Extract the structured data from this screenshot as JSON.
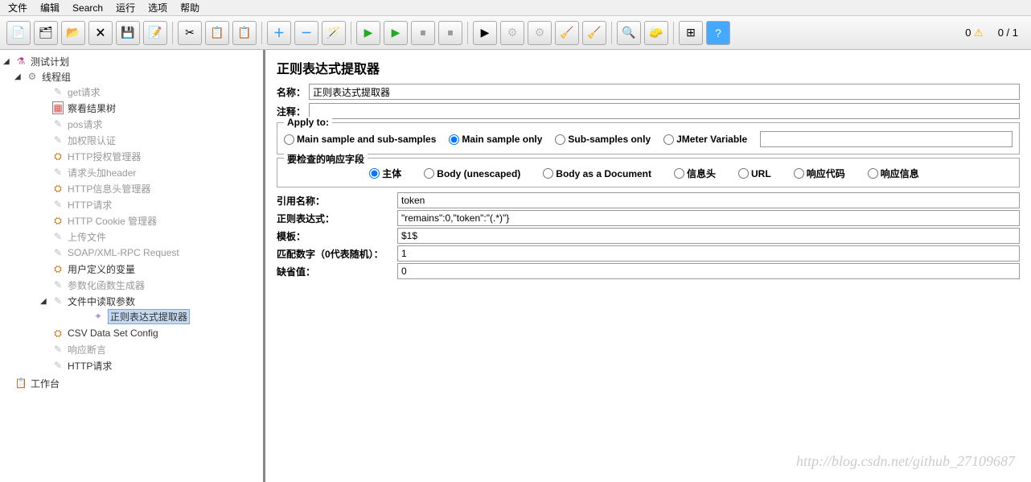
{
  "menu": {
    "file": "文件",
    "edit": "编辑",
    "search": "Search",
    "run": "运行",
    "options": "选项",
    "help": "帮助"
  },
  "status": {
    "warnCount": "0",
    "warnIcon": "⚠",
    "threads": "0 / 1"
  },
  "tree": {
    "root": "测试计划",
    "threadGroup": "线程组",
    "items": [
      {
        "label": "get请求",
        "grey": true,
        "icon": "pencil"
      },
      {
        "label": "察看结果树",
        "grey": false,
        "icon": "tree"
      },
      {
        "label": "pos请求",
        "grey": true,
        "icon": "pencil"
      },
      {
        "label": "加权限认证",
        "grey": true,
        "icon": "pencil"
      },
      {
        "label": "HTTP授权管理器",
        "grey": true,
        "icon": "config"
      },
      {
        "label": "请求头加header",
        "grey": true,
        "icon": "pencil"
      },
      {
        "label": "HTTP信息头管理器",
        "grey": true,
        "icon": "config"
      },
      {
        "label": "HTTP请求",
        "grey": true,
        "icon": "pencil"
      },
      {
        "label": "HTTP Cookie 管理器",
        "grey": true,
        "icon": "config"
      },
      {
        "label": "上传文件",
        "grey": true,
        "icon": "pencil"
      },
      {
        "label": "SOAP/XML-RPC Request",
        "grey": true,
        "icon": "pencil"
      },
      {
        "label": "用户定义的变量",
        "grey": false,
        "icon": "config"
      },
      {
        "label": "参数化函数生成器",
        "grey": true,
        "icon": "pencil"
      }
    ],
    "fileParams": "文件中读取参数",
    "regex": "正则表达式提取器",
    "csv": "CSV Data Set Config",
    "assert": "响应断言",
    "http": "HTTP请求",
    "workbench": "工作台"
  },
  "panel": {
    "title": "正则表达式提取器",
    "nameLabel": "名称：",
    "nameValue": "正则表达式提取器",
    "commentLabel": "注释：",
    "commentValue": "",
    "applyLegend": "Apply to:",
    "applyOptions": {
      "a": "Main sample and sub-samples",
      "b": "Main sample only",
      "c": "Sub-samples only",
      "d": "JMeter Variable"
    },
    "jmeterVarValue": "",
    "respLegend": "要检查的响应字段",
    "respOptions": {
      "a": "主体",
      "b": "Body (unescaped)",
      "c": "Body as a Document",
      "d": "信息头",
      "e": "URL",
      "f": "响应代码",
      "g": "响应信息"
    },
    "refNameLabel": "引用名称：",
    "refNameValue": "token",
    "regexLabel": "正则表达式：",
    "regexValue": "\"remains\":0,\"token\":\"(.*)\"}",
    "templateLabel": "模板：",
    "templateValue": "$1$",
    "matchLabel": "匹配数字（0代表随机）：",
    "matchValue": "1",
    "defaultLabel": "缺省值：",
    "defaultValue": "0"
  },
  "watermark": "http://blog.csdn.net/github_27109687"
}
